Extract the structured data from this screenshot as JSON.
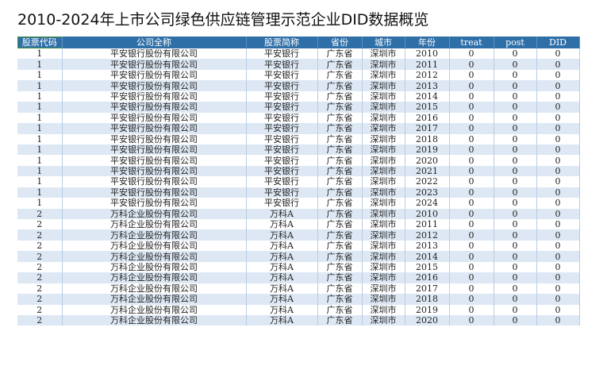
{
  "title": "2010-2024年上市公司绿色供应链管理示范企业DID数据概览",
  "table": {
    "headers": [
      "股票代码",
      "公司全称",
      "股票简称",
      "省份",
      "城市",
      "年份",
      "treat",
      "post",
      "DID"
    ],
    "rows": [
      [
        "1",
        "平安银行股份有限公司",
        "平安银行",
        "广东省",
        "深圳市",
        "2010",
        "0",
        "0",
        "0"
      ],
      [
        "1",
        "平安银行股份有限公司",
        "平安银行",
        "广东省",
        "深圳市",
        "2011",
        "0",
        "0",
        "0"
      ],
      [
        "1",
        "平安银行股份有限公司",
        "平安银行",
        "广东省",
        "深圳市",
        "2012",
        "0",
        "0",
        "0"
      ],
      [
        "1",
        "平安银行股份有限公司",
        "平安银行",
        "广东省",
        "深圳市",
        "2013",
        "0",
        "0",
        "0"
      ],
      [
        "1",
        "平安银行股份有限公司",
        "平安银行",
        "广东省",
        "深圳市",
        "2014",
        "0",
        "0",
        "0"
      ],
      [
        "1",
        "平安银行股份有限公司",
        "平安银行",
        "广东省",
        "深圳市",
        "2015",
        "0",
        "0",
        "0"
      ],
      [
        "1",
        "平安银行股份有限公司",
        "平安银行",
        "广东省",
        "深圳市",
        "2016",
        "0",
        "0",
        "0"
      ],
      [
        "1",
        "平安银行股份有限公司",
        "平安银行",
        "广东省",
        "深圳市",
        "2017",
        "0",
        "0",
        "0"
      ],
      [
        "1",
        "平安银行股份有限公司",
        "平安银行",
        "广东省",
        "深圳市",
        "2018",
        "0",
        "0",
        "0"
      ],
      [
        "1",
        "平安银行股份有限公司",
        "平安银行",
        "广东省",
        "深圳市",
        "2019",
        "0",
        "0",
        "0"
      ],
      [
        "1",
        "平安银行股份有限公司",
        "平安银行",
        "广东省",
        "深圳市",
        "2020",
        "0",
        "0",
        "0"
      ],
      [
        "1",
        "平安银行股份有限公司",
        "平安银行",
        "广东省",
        "深圳市",
        "2021",
        "0",
        "0",
        "0"
      ],
      [
        "1",
        "平安银行股份有限公司",
        "平安银行",
        "广东省",
        "深圳市",
        "2022",
        "0",
        "0",
        "0"
      ],
      [
        "1",
        "平安银行股份有限公司",
        "平安银行",
        "广东省",
        "深圳市",
        "2023",
        "0",
        "0",
        "0"
      ],
      [
        "1",
        "平安银行股份有限公司",
        "平安银行",
        "广东省",
        "深圳市",
        "2024",
        "0",
        "0",
        "0"
      ],
      [
        "2",
        "万科企业股份有限公司",
        "万科A",
        "广东省",
        "深圳市",
        "2010",
        "0",
        "0",
        "0"
      ],
      [
        "2",
        "万科企业股份有限公司",
        "万科A",
        "广东省",
        "深圳市",
        "2011",
        "0",
        "0",
        "0"
      ],
      [
        "2",
        "万科企业股份有限公司",
        "万科A",
        "广东省",
        "深圳市",
        "2012",
        "0",
        "0",
        "0"
      ],
      [
        "2",
        "万科企业股份有限公司",
        "万科A",
        "广东省",
        "深圳市",
        "2013",
        "0",
        "0",
        "0"
      ],
      [
        "2",
        "万科企业股份有限公司",
        "万科A",
        "广东省",
        "深圳市",
        "2014",
        "0",
        "0",
        "0"
      ],
      [
        "2",
        "万科企业股份有限公司",
        "万科A",
        "广东省",
        "深圳市",
        "2015",
        "0",
        "0",
        "0"
      ],
      [
        "2",
        "万科企业股份有限公司",
        "万科A",
        "广东省",
        "深圳市",
        "2016",
        "0",
        "0",
        "0"
      ],
      [
        "2",
        "万科企业股份有限公司",
        "万科A",
        "广东省",
        "深圳市",
        "2017",
        "0",
        "0",
        "0"
      ],
      [
        "2",
        "万科企业股份有限公司",
        "万科A",
        "广东省",
        "深圳市",
        "2018",
        "0",
        "0",
        "0"
      ],
      [
        "2",
        "万科企业股份有限公司",
        "万科A",
        "广东省",
        "深圳市",
        "2019",
        "0",
        "0",
        "0"
      ],
      [
        "2",
        "万科企业股份有限公司",
        "万科A",
        "广东省",
        "深圳市",
        "2020",
        "0",
        "0",
        "0"
      ]
    ]
  },
  "colors": {
    "header_bg": "#2f6fa8",
    "row_alt_bg": "#dde8f4",
    "selected_cell_border": "#3a8f3a"
  }
}
